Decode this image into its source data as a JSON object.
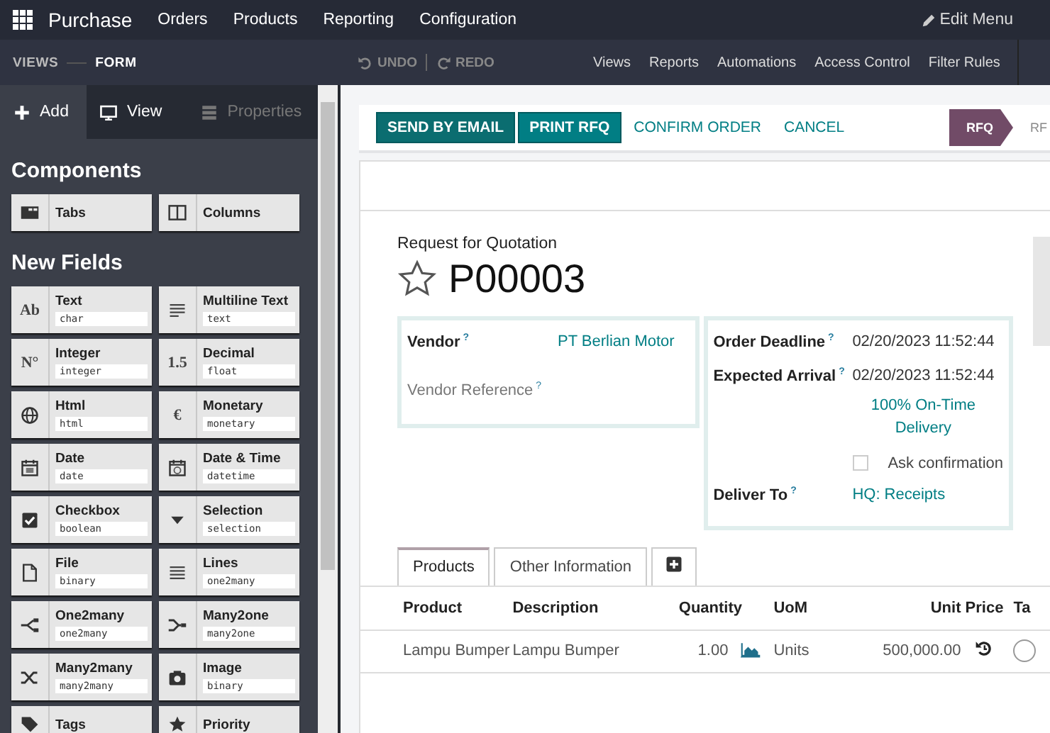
{
  "app_bar": {
    "app_name": "Purchase",
    "menus": [
      "Orders",
      "Products",
      "Reporting",
      "Configuration"
    ],
    "edit_menu": "Edit Menu"
  },
  "studio_bar": {
    "breadcrumbs": [
      "VIEWS",
      "FORM"
    ],
    "undo": "UNDO",
    "redo": "REDO",
    "links": [
      "Views",
      "Reports",
      "Automations",
      "Access Control",
      "Filter Rules"
    ]
  },
  "sidebar": {
    "tabs": [
      {
        "label": "Add",
        "selected": true,
        "disabled": false
      },
      {
        "label": "View",
        "selected": false,
        "disabled": false
      },
      {
        "label": "Properties",
        "selected": false,
        "disabled": true
      }
    ],
    "sections": [
      {
        "title": "Components",
        "items": [
          {
            "label": "Tabs"
          },
          {
            "label": "Columns"
          }
        ]
      },
      {
        "title": "New Fields",
        "items": [
          {
            "label": "Text",
            "type": "char",
            "glyph": "Ab"
          },
          {
            "label": "Multiline Text",
            "type": "text"
          },
          {
            "label": "Integer",
            "type": "integer",
            "glyph": "N°"
          },
          {
            "label": "Decimal",
            "type": "float",
            "glyph": "1.5"
          },
          {
            "label": "Html",
            "type": "html"
          },
          {
            "label": "Monetary",
            "type": "monetary",
            "glyph": "€"
          },
          {
            "label": "Date",
            "type": "date"
          },
          {
            "label": "Date & Time",
            "type": "datetime"
          },
          {
            "label": "Checkbox",
            "type": "boolean"
          },
          {
            "label": "Selection",
            "type": "selection"
          },
          {
            "label": "File",
            "type": "binary"
          },
          {
            "label": "Lines",
            "type": "one2many"
          },
          {
            "label": "One2many",
            "type": "one2many"
          },
          {
            "label": "Many2one",
            "type": "many2one"
          },
          {
            "label": "Many2many",
            "type": "many2many"
          },
          {
            "label": "Image",
            "type": "binary"
          },
          {
            "label": "Tags"
          },
          {
            "label": "Priority"
          }
        ]
      }
    ]
  },
  "control_panel": {
    "buttons": [
      {
        "label": "SEND BY EMAIL",
        "kind": "primary"
      },
      {
        "label": "PRINT RFQ",
        "kind": "primary"
      },
      {
        "label": "CONFIRM ORDER",
        "kind": "link"
      },
      {
        "label": "CANCEL",
        "kind": "link"
      }
    ],
    "statusbar": [
      {
        "label": "RFQ",
        "selected": true
      },
      {
        "label": "RF",
        "selected": false
      }
    ]
  },
  "form": {
    "subtitle": "Request for Quotation",
    "name": "P00003",
    "starred": false,
    "left_group": [
      {
        "label": "Vendor",
        "help": "?",
        "required": true,
        "value": "PT Berlian Motor"
      },
      {
        "label": "Vendor Reference",
        "help": "?",
        "required": false
      }
    ],
    "right_group": [
      {
        "label": "Order Deadline",
        "help": "?",
        "required": true,
        "value": "02/20/2023 11:52:44",
        "kind": "text"
      },
      {
        "label": "Expected Arrival",
        "help": "?",
        "required": true,
        "value": "02/20/2023 11:52:44",
        "kind": "text",
        "extra": "100% On-Time Delivery"
      },
      {
        "kind": "checkbox",
        "label": "Ask confirmation",
        "checked": false
      },
      {
        "label": "Deliver To",
        "help": "?",
        "required": true,
        "value": "HQ: Receipts",
        "kind": "link"
      }
    ],
    "notebook": [
      {
        "label": "Products",
        "selected": true
      },
      {
        "label": "Other Information",
        "selected": false
      }
    ],
    "table": {
      "columns": [
        "Product",
        "Description",
        "Quantity",
        "UoM",
        "Unit Price",
        "Ta"
      ],
      "rows": [
        {
          "product": "Lampu Bumper",
          "description": "Lampu Bumper",
          "quantity": "1.00",
          "uom": "Units",
          "unit_price": "500,000.00"
        }
      ]
    }
  }
}
